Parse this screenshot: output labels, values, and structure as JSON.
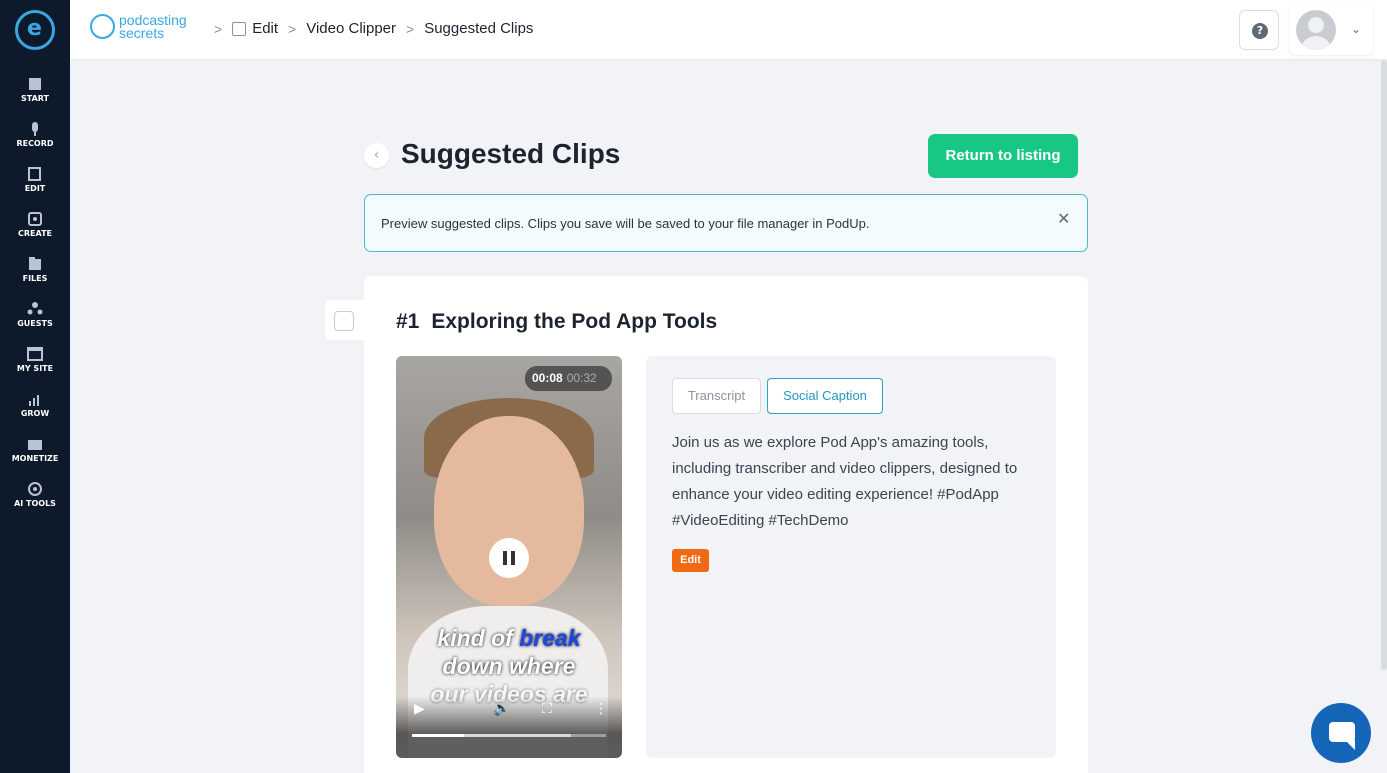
{
  "sidebar": {
    "logo_glyph": "e",
    "items": [
      {
        "label": "START",
        "icon": "start-icon"
      },
      {
        "label": "RECORD",
        "icon": "microphone-icon"
      },
      {
        "label": "EDIT",
        "icon": "edit-icon"
      },
      {
        "label": "CREATE",
        "icon": "create-icon"
      },
      {
        "label": "FILES",
        "icon": "files-icon"
      },
      {
        "label": "GUESTS",
        "icon": "guests-icon"
      },
      {
        "label": "MY SITE",
        "icon": "my-site-icon"
      },
      {
        "label": "GROW",
        "icon": "grow-icon"
      },
      {
        "label": "MONETIZE",
        "icon": "monetize-icon"
      },
      {
        "label": "AI TOOLS",
        "icon": "ai-tools-icon"
      }
    ]
  },
  "header": {
    "brand_line1": "podcasting",
    "brand_line2": "secrets",
    "breadcrumb": [
      "Edit",
      "Video Clipper",
      "Suggested Clips"
    ],
    "help_glyph": "?"
  },
  "page": {
    "title": "Suggested Clips",
    "return_button": "Return to listing",
    "notice": "Preview suggested clips. Clips you save will be saved to your file manager in PodUp."
  },
  "clip": {
    "number": "#1",
    "title": "Exploring the Pod App Tools",
    "time_current": "00:08",
    "time_total": "00:32",
    "progress_played": 0.27,
    "progress_buffered": 0.82,
    "caption_line1_a": "kind of ",
    "caption_line1_b": "break",
    "caption_line2": "down where",
    "caption_line3": "our videos are",
    "tabs": [
      "Transcript",
      "Social Caption"
    ],
    "active_tab": "Social Caption",
    "social_caption": "Join us as we explore Pod App's amazing tools, including transcriber and video clippers, designed to enhance your video editing experience! #PodApp #VideoEditing #TechDemo",
    "edit_label": "Edit"
  },
  "colors": {
    "sidebar_bg": "#0c1a2b",
    "accent_green": "#19c784",
    "accent_blue": "#2197bd",
    "edit_orange": "#f06a14"
  }
}
